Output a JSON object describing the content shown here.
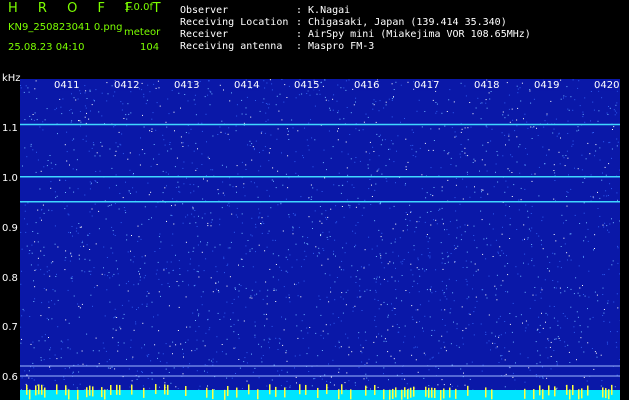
{
  "app": {
    "title": "H R O F F T",
    "version": "1.0.0f",
    "filename": "KN9_250823041 0.png",
    "datetime": "25.08.23 04:10",
    "mode": "meteor",
    "count": "104"
  },
  "station": {
    "rows": [
      {
        "label": "Observer",
        "value": ": K.Nagai"
      },
      {
        "label": "Receiving Location",
        "value": ": Chigasaki, Japan (139.414 35.340)"
      },
      {
        "label": "Receiver",
        "value": ": AirSpy mini (Miakejima VOR 108.65MHz)"
      },
      {
        "label": "Receiving antenna",
        "value": ": Maspro FM-3"
      }
    ]
  },
  "spectrogram": {
    "unit": "kHz",
    "freq_labels": [
      "1.1",
      "1.0",
      "0.9",
      "0.8",
      "0.7",
      "0.6"
    ],
    "time_labels": [
      "0411",
      "0412",
      "0413",
      "0414",
      "0415",
      "0416",
      "0417",
      "0418",
      "0419",
      "0420"
    ],
    "carrier_khz": [
      1.105,
      1.0,
      0.95,
      0.62,
      0.6
    ],
    "colors": {
      "background": "#0a18a8",
      "noise": "#ffffff",
      "carrier": "#3fd6ff",
      "bottom_band": "#00e5ff"
    }
  }
}
